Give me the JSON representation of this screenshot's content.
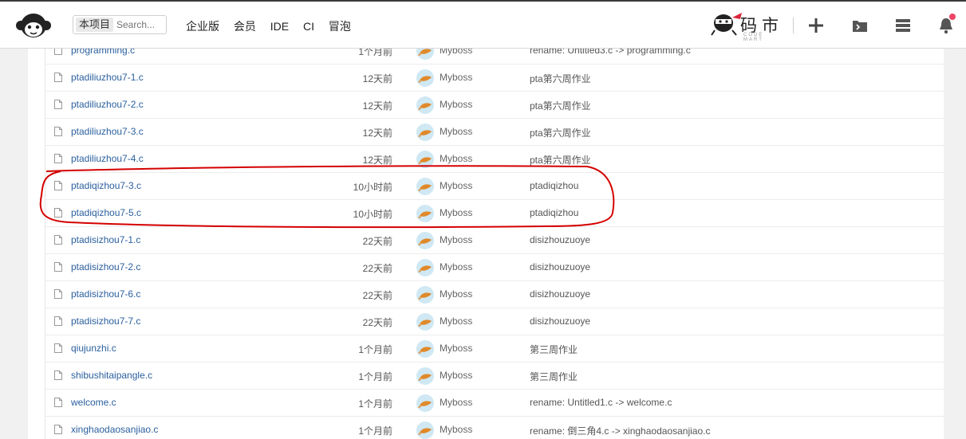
{
  "header": {
    "search_scope": "本项目",
    "search_placeholder": "Search...",
    "nav": [
      "企业版",
      "会员",
      "IDE",
      "CI",
      "冒泡"
    ],
    "brand_text": "码市",
    "brand_sub": "CODE MART"
  },
  "colors": {
    "link": "#2a5f9e",
    "highlight": "#d40000",
    "notification": "#ee4466"
  },
  "files": [
    {
      "name": "programming.c",
      "time": "1个月前",
      "author": "Myboss",
      "message": "rename: Untitled3.c -> programming.c"
    },
    {
      "name": "ptadiliuzhou7-1.c",
      "time": "12天前",
      "author": "Myboss",
      "message": "pta第六周作业"
    },
    {
      "name": "ptadiliuzhou7-2.c",
      "time": "12天前",
      "author": "Myboss",
      "message": "pta第六周作业"
    },
    {
      "name": "ptadiliuzhou7-3.c",
      "time": "12天前",
      "author": "Myboss",
      "message": "pta第六周作业"
    },
    {
      "name": "ptadiliuzhou7-4.c",
      "time": "12天前",
      "author": "Myboss",
      "message": "pta第六周作业"
    },
    {
      "name": "ptadiqizhou7-3.c",
      "time": "10小时前",
      "author": "Myboss",
      "message": "ptadiqizhou"
    },
    {
      "name": "ptadiqizhou7-5.c",
      "time": "10小时前",
      "author": "Myboss",
      "message": "ptadiqizhou"
    },
    {
      "name": "ptadisizhou7-1.c",
      "time": "22天前",
      "author": "Myboss",
      "message": "disizhouzuoye"
    },
    {
      "name": "ptadisizhou7-2.c",
      "time": "22天前",
      "author": "Myboss",
      "message": "disizhouzuoye"
    },
    {
      "name": "ptadisizhou7-6.c",
      "time": "22天前",
      "author": "Myboss",
      "message": "disizhouzuoye"
    },
    {
      "name": "ptadisizhou7-7.c",
      "time": "22天前",
      "author": "Myboss",
      "message": "disizhouzuoye"
    },
    {
      "name": "qiujunzhi.c",
      "time": "1个月前",
      "author": "Myboss",
      "message": "第三周作业"
    },
    {
      "name": "shibushitaipangle.c",
      "time": "1个月前",
      "author": "Myboss",
      "message": "第三周作业"
    },
    {
      "name": "welcome.c",
      "time": "1个月前",
      "author": "Myboss",
      "message": "rename: Untitled1.c -> welcome.c"
    },
    {
      "name": "xinghaodaosanjiao.c",
      "time": "1个月前",
      "author": "Myboss",
      "message": "rename: 倒三角4.c -> xinghaodaosanjiao.c"
    }
  ]
}
